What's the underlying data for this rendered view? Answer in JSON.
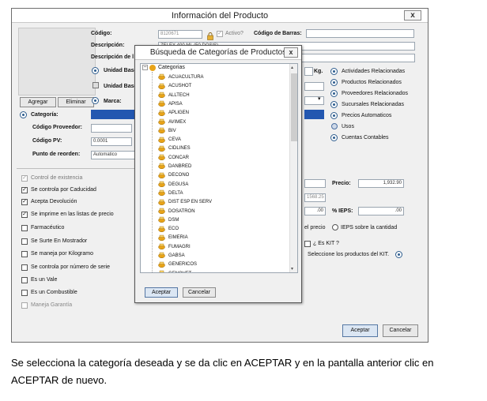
{
  "window": {
    "title": "Información del Producto",
    "close": "x"
  },
  "product": {
    "codigo_label": "Código:",
    "codigo_value": "8120671",
    "activo_label": "Activo?",
    "barras_label": "Código de Barras:",
    "descripcion_label": "Descripción:",
    "descripcion_value": "ZELEX 400 ML (50 DOSIS)",
    "descripcion2_label": "Descripción de l",
    "unidad_base1_label": "Unidad Base",
    "unidad_base2_label": "Unidad Base",
    "kg_label": "Kg.",
    "marca_label": "Marca:",
    "categoria_label": "Categoría:",
    "proveedor_label": "Código Proveedor:",
    "pv_label": "Código PV:",
    "pv_value": "0.0001",
    "reorden_label": "Punto de reorden:",
    "reorden_value": "Automatico"
  },
  "photo_buttons": {
    "agregar": "Agregar",
    "eliminar": "Eliminar"
  },
  "side_links": [
    "Actividades Relacionadas",
    "Productos Relacionados",
    "Proveedores Relacionados",
    "Sucursales Relacionadas",
    "Precios Automaticos",
    "Usos",
    "Cuentas Contables"
  ],
  "checkboxes": [
    {
      "label": "Control de existencia",
      "checked": "✓",
      "disabled": true
    },
    {
      "label": "Se controla por Caducidad",
      "checked": "✓",
      "disabled": false
    },
    {
      "label": "Acepta Devolución",
      "checked": "✓",
      "disabled": false
    },
    {
      "label": "Se imprime en las listas de precio",
      "checked": "✓",
      "disabled": false
    },
    {
      "label": "Farmacéutico",
      "checked": "",
      "disabled": false
    },
    {
      "label": "Se Surte En Mostrador",
      "checked": "",
      "disabled": false
    },
    {
      "label": "Se maneja por Kilogramo",
      "checked": "",
      "disabled": false
    },
    {
      "label": "Se controla por número de serie",
      "checked": "",
      "disabled": false
    },
    {
      "label": "Es un Vale",
      "checked": "",
      "disabled": false
    },
    {
      "label": "Es un Combustible",
      "checked": "",
      "disabled": false
    },
    {
      "label": "Maneja Garantía",
      "checked": "",
      "disabled": true
    }
  ],
  "pricing": {
    "precio_label": "Precio:",
    "precio_value": "1,932.90",
    "costo_value": "1568.25",
    "val1": ".00",
    "ieps_label": "% IEPS:",
    "ieps_value": ".00",
    "el_precio": "el precio",
    "ieps_cantidad": "IEPS sobre la cantidad",
    "kit_label": "¿ Es KIT ?",
    "kit_link": "Seleccione los productos del KIT."
  },
  "main_buttons": {
    "aceptar": "Aceptar",
    "cancelar": "Cancelar"
  },
  "dialog": {
    "title": "Búsqueda de Categorías de Productos",
    "close": "x",
    "root_label": "Categorias",
    "expander": "−",
    "categories": [
      "ACUACULTURA",
      "ACUSHOT",
      "ALLTECH",
      "APISA",
      "APLIGEN",
      "AVIMEX",
      "BIV",
      "CEVA",
      "CIDLINES",
      "CONCAR",
      "DANBRED",
      "DECONO",
      "DEGUSA",
      "DELTA",
      "DIST ESP EN SERV",
      "DOSATRON",
      "DSM",
      "ECO",
      "EIMERIA",
      "FUMAGRI",
      "GABSA",
      "GENERICOS",
      "GENOVET"
    ],
    "aceptar": "Aceptar",
    "cancelar": "Cancelar"
  },
  "caption": {
    "line1": "Se selecciona la categoría deseada y se da clic en ACEPTAR y en la pantalla anterior clic en",
    "line2": "ACEPTAR de nuevo."
  },
  "colors": {
    "accent": "#2e5d8e",
    "selection": "#2357b0",
    "folder": "#e8a318"
  }
}
